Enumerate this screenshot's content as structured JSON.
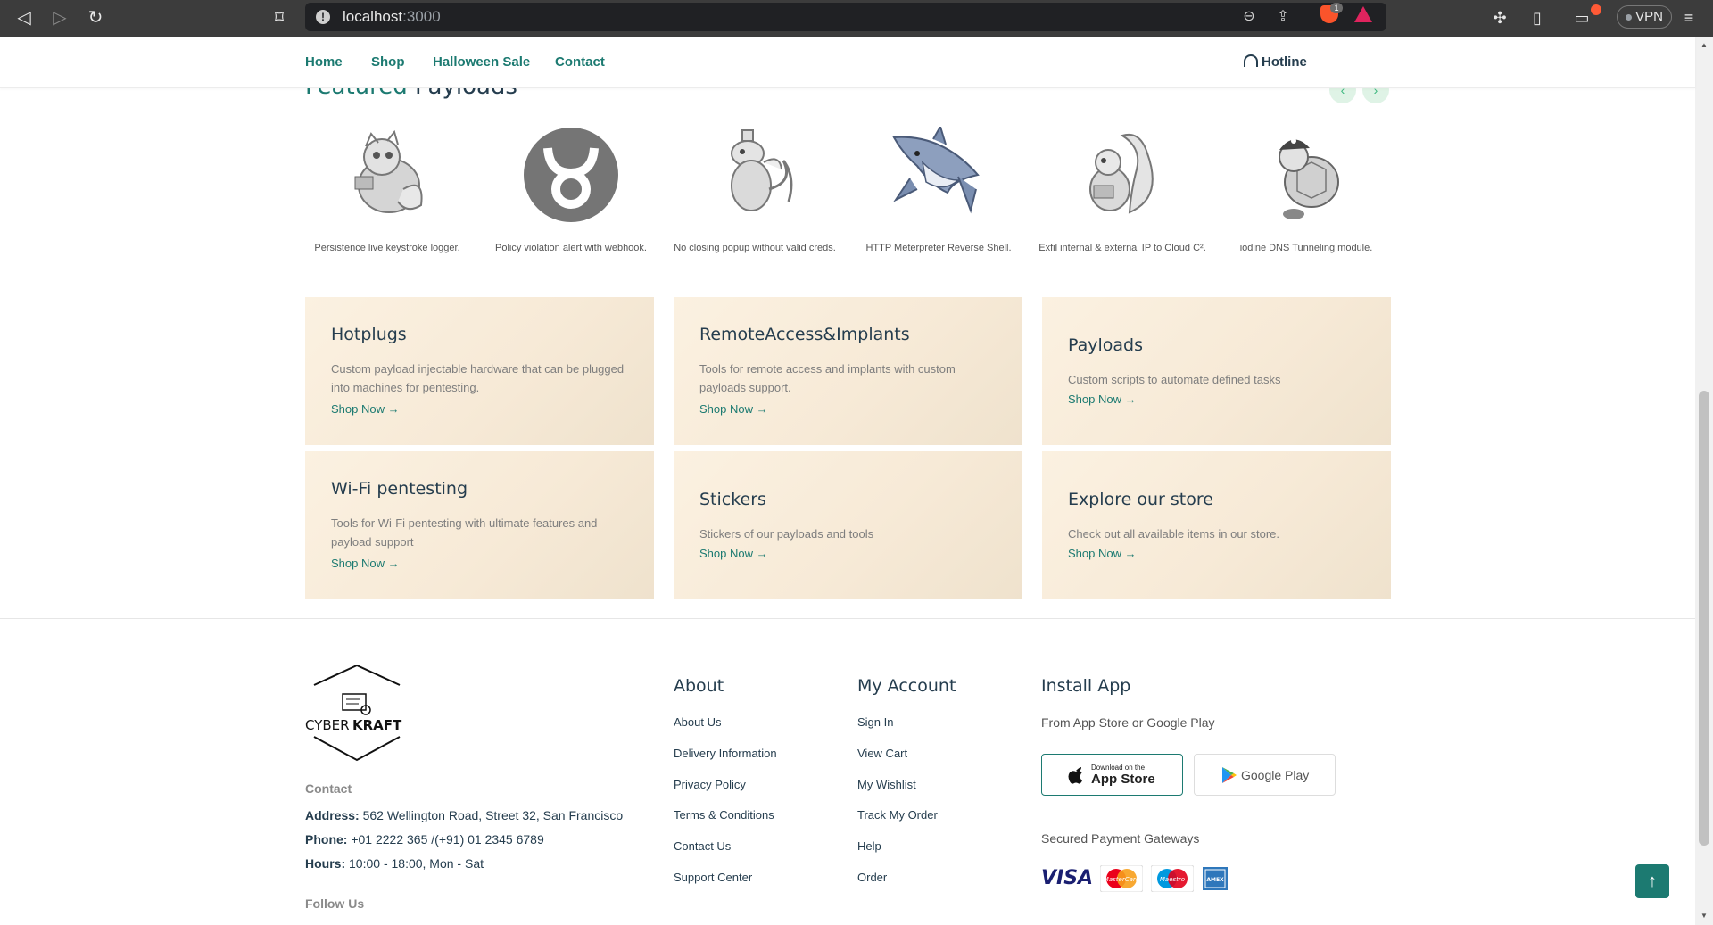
{
  "browser": {
    "url_host": "localhost",
    "url_port": ":3000",
    "brave_badge": "1",
    "vpn_label": "VPN"
  },
  "nav": {
    "links": [
      "Home",
      "Shop",
      "Halloween Sale",
      "Contact"
    ],
    "hotline": "Hotline"
  },
  "featured": {
    "title_highlight": "Featured",
    "title_rest": "Payloads",
    "items": [
      {
        "caption": "Persistence live keystroke logger.",
        "icon": "mascot-creature-icon"
      },
      {
        "caption": "Policy violation alert with webhook.",
        "icon": "bull-logo-icon"
      },
      {
        "caption": "No closing popup without valid creds.",
        "icon": "dragon-mascot-icon"
      },
      {
        "caption": "HTTP Meterpreter Reverse Shell.",
        "icon": "shark-icon"
      },
      {
        "caption": "Exfil internal & external IP to Cloud C².",
        "icon": "squirrel-mascot-icon"
      },
      {
        "caption": "iodine DNS Tunneling module.",
        "icon": "turtle-pirate-icon"
      }
    ]
  },
  "categories": [
    {
      "title": "Hotplugs",
      "desc": "Custom payload injectable hardware that can be plugged into machines for pentesting.",
      "link": "Shop Now →"
    },
    {
      "title": "RemoteAccess&Implants",
      "desc": "Tools for remote access and implants with custom payloads support.",
      "link": "Shop Now →"
    },
    {
      "title": "Payloads",
      "desc": "Custom scripts to automate defined tasks",
      "link": "Shop Now →"
    },
    {
      "title": "Wi-Fi pentesting",
      "desc": "Tools for Wi-Fi pentesting with ultimate features and payload support",
      "link": "Shop Now →"
    },
    {
      "title": "Stickers",
      "desc": "Stickers of our payloads and tools",
      "link": "Shop Now →"
    },
    {
      "title": "Explore our store",
      "desc": "Check out all available items in our store.",
      "link": "Shop Now →"
    }
  ],
  "footer": {
    "logo_text_light": "CYBER",
    "logo_text_bold": "KRAFT",
    "contact_heading": "Contact",
    "address_label": "Address:",
    "address": " 562 Wellington Road, Street 32, San Francisco",
    "phone_label": "Phone:",
    "phone": " +01 2222 365 /(+91) 01 2345 6789",
    "hours_label": "Hours:",
    "hours": " 10:00 - 18:00, Mon - Sat",
    "follow_heading": "Follow Us",
    "about_heading": "About",
    "about_links": [
      "About Us",
      "Delivery Information",
      "Privacy Policy",
      "Terms & Conditions",
      "Contact Us",
      "Support Center"
    ],
    "account_heading": "My Account",
    "account_links": [
      "Sign In",
      "View Cart",
      "My Wishlist",
      "Track My Order",
      "Help",
      "Order"
    ],
    "app_heading": "Install App",
    "app_sub": "From App Store or Google Play",
    "appstore_small": "Download on the",
    "appstore_big": "App Store",
    "googleplay": "Google Play",
    "payment_heading": "Secured Payment Gateways",
    "payment_brands": [
      "VISA",
      "MasterCard",
      "Maestro",
      "AMEX"
    ]
  },
  "colors": {
    "brand": "#1c7a71",
    "heading": "#253d4e",
    "banner_bg": "#fbf1e1"
  }
}
